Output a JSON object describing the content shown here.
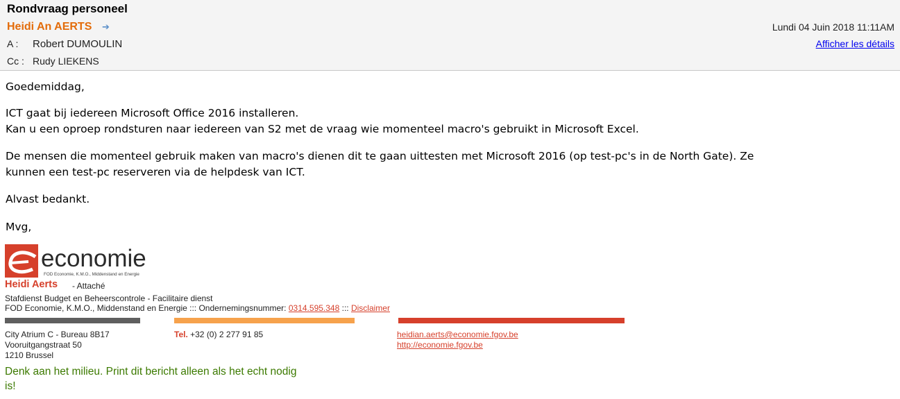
{
  "header": {
    "subject": "Rondvraag personeel",
    "sender": "Heidi An AERTS",
    "to_label": "A :",
    "to_value": "Robert DUMOULIN",
    "cc_label": "Cc :",
    "cc_value": "Rudy LIEKENS",
    "date": "Lundi 04 Juin 2018 11:11AM",
    "details_link": "Afficher les détails"
  },
  "body": {
    "greeting": "Goedemiddag,",
    "p1_line1": "ICT gaat bij iedereen Microsoft Office 2016 installeren.",
    "p1_line2": "Kan u een oproep rondsturen naar iedereen van S2 met de vraag wie momenteel macro's gebruikt in Microsoft Excel.",
    "p2_line1": "De mensen die momenteel gebruik maken van macro's dienen dit te gaan uittesten met Microsoft 2016 (op test-pc's in de North Gate). Ze",
    "p2_line2": "kunnen een test-pc reserveren via de helpdesk van ICT.",
    "thanks": "Alvast bedankt.",
    "closing": "Mvg,"
  },
  "signature": {
    "logo_word": "economie",
    "logo_sub": "FOD Economie, K.M.O., Middenstand en Energie",
    "name": "Heidi Aerts",
    "role": "- Attaché",
    "dept": "Stafdienst Budget en Beheerscontrole - Facilitaire dienst",
    "org_prefix": "FOD Economie, K.M.O., Middenstand en Energie ::: Ondernemingsnummer:",
    "company_number": "0314.595.348",
    "separator": ":::",
    "disclaimer": "Disclaimer",
    "address_line1": "City Atrium C - Bureau 8B17",
    "address_line2": "Vooruitgangstraat 50",
    "address_line3": "1210 Brussel",
    "tel_label": "Tel.",
    "tel_value": "+32 (0) 2 277 91 85",
    "email": "heidian.aerts@economie.fgov.be",
    "website": "http://economie.fgov.be",
    "eco_notice": "Denk aan het milieu. Print dit bericht alleen als het echt nodig is!"
  },
  "colors": {
    "sender_orange": "#e36c0a",
    "brand_red": "#d6402b",
    "bar_gray": "#5f5f5f",
    "bar_orange": "#f6a24c",
    "bar_red": "#d6402b",
    "eco_green": "#3c7a00",
    "link_blue": "#0000ee"
  }
}
